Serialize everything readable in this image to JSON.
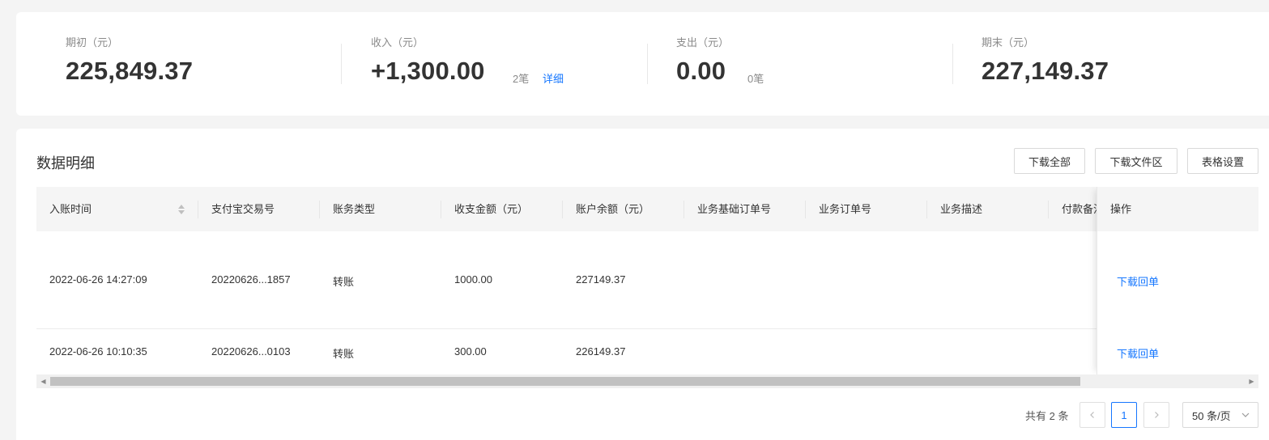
{
  "summary": {
    "opening": {
      "label": "期初（元）",
      "value": "225,849.37"
    },
    "income": {
      "label": "收入（元）",
      "value": "+1,300.00",
      "count": "2笔",
      "detail_link": "详细"
    },
    "expense": {
      "label": "支出（元）",
      "value": "0.00",
      "count": "0笔"
    },
    "closing": {
      "label": "期末（元）",
      "value": "227,149.37"
    }
  },
  "detail": {
    "title": "数据明细",
    "buttons": {
      "download_all": "下载全部",
      "download_files": "下载文件区",
      "table_settings": "表格设置"
    }
  },
  "table": {
    "columns": [
      "入账时间",
      "支付宝交易号",
      "账务类型",
      "收支金额（元）",
      "账户余额（元）",
      "业务基础订单号",
      "业务订单号",
      "业务描述",
      "付款备注",
      "操作"
    ],
    "rows": [
      {
        "time": "2022-06-26 14:27:09",
        "trade_no": "20220626...1857",
        "type": "转账",
        "amount": "1000.00",
        "balance": "227149.37",
        "action": "下载回单"
      },
      {
        "time": "2022-06-26 10:10:35",
        "trade_no": "20220626...0103",
        "type": "转账",
        "amount": "300.00",
        "balance": "226149.37",
        "action": "下载回单"
      }
    ]
  },
  "pagination": {
    "total_text": "共有 2 条",
    "current_page": "1",
    "page_size": "50 条/页"
  },
  "icons": {
    "sort": "sort-icon",
    "prev": "chevron-left-icon",
    "next": "chevron-right-icon",
    "select": "chevron-down-icon"
  },
  "colors": {
    "link": "#1677ff",
    "background": "#f4f4f4"
  }
}
